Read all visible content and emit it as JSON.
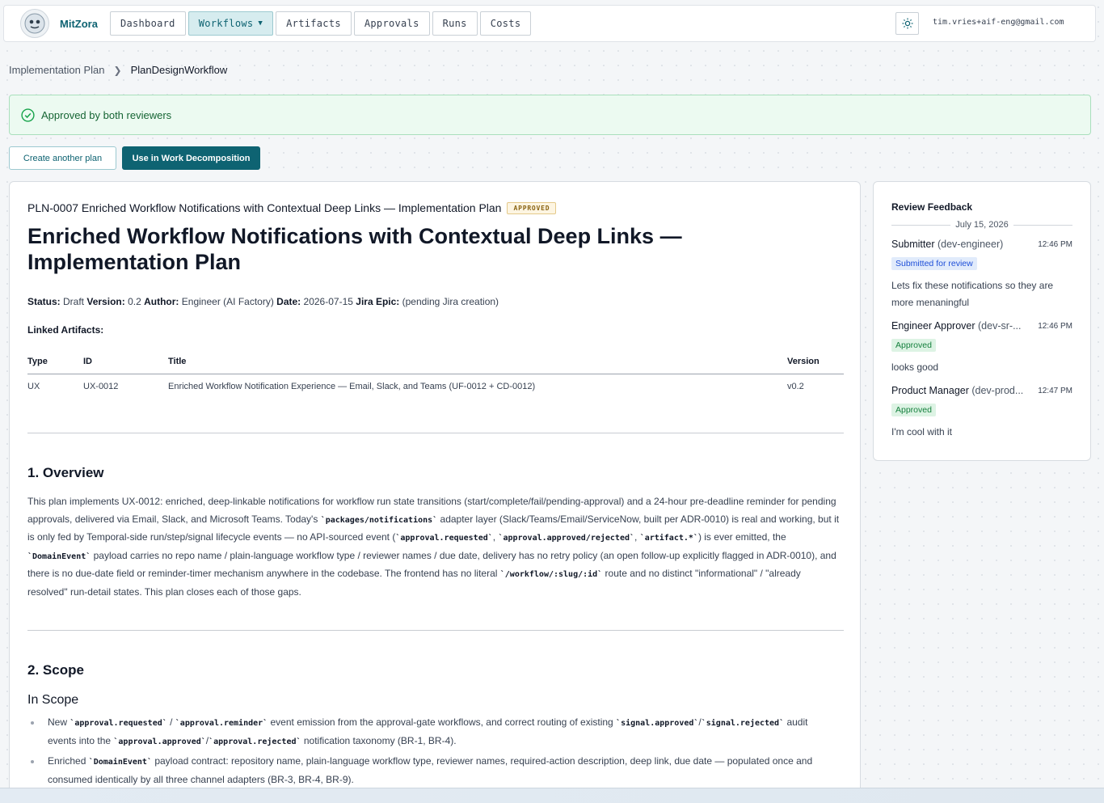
{
  "app": {
    "brand": "MitZora",
    "nav": [
      {
        "label": "Dashboard"
      },
      {
        "label": "Workflows"
      },
      {
        "label": "Artifacts"
      },
      {
        "label": "Approvals"
      },
      {
        "label": "Runs"
      },
      {
        "label": "Costs"
      }
    ],
    "user_email": "tim.vries+aif-eng@gmail.com"
  },
  "breadcrumb": [
    "Implementation Plan",
    "PlanDesignWorkflow"
  ],
  "alert": {
    "text": "Approved by both reviewers"
  },
  "actions": {
    "secondary": "Create another plan",
    "primary": "Use in Work Decomposition"
  },
  "doc": {
    "header": "PLN-0007 Enriched Workflow Notifications with Contextual Deep Links — Implementation Plan",
    "status_badge": "APPROVED",
    "title": "Enriched Workflow Notifications with Contextual Deep Links — Implementation Plan",
    "meta": {
      "status_label": "Status:",
      "status": "Draft",
      "version_label": "Version:",
      "version": "0.2",
      "author_label": "Author:",
      "author": "Engineer (AI Factory)",
      "date_label": "Date:",
      "date": "2026-07-15",
      "jira_label": "Jira Epic:",
      "jira": "(pending Jira creation)"
    },
    "linked_label": "Linked Artifacts:",
    "table": {
      "headers": [
        "Type",
        "ID",
        "Title",
        "Version"
      ],
      "rows": [
        [
          "UX",
          "UX-0012",
          "Enriched Workflow Notification Experience — Email, Slack, and Teams (UF-0012 + CD-0012)",
          "v0.2"
        ]
      ]
    },
    "overview": {
      "heading": "1. Overview",
      "t1": "This plan implements UX-0012: enriched, deep-linkable notifications for workflow run state transitions (start/complete/fail/pending-approval) and a 24-hour pre-deadline reminder for pending approvals, delivered via Email, Slack, and Microsoft Teams. Today's ",
      "c1": "`packages/notifications`",
      "t2": " adapter layer (Slack/Teams/Email/ServiceNow, built per ADR-0010) is real and working, but it is only fed by Temporal-side run/step/signal lifecycle events — no API-sourced event (",
      "c2": "`approval.requested`",
      "t3": ", ",
      "c3": "`approval.approved/rejected`",
      "t4": ", ",
      "c4": "`artifact.*`",
      "t5": ") is ever emitted, the ",
      "c5": "`DomainEvent`",
      "t6": " payload carries no repo name / plain-language workflow type / reviewer names / due date, delivery has no retry policy (an open follow-up explicitly flagged in ADR-0010), and there is no due-date field or reminder-timer mechanism anywhere in the codebase. The frontend has no literal ",
      "c6": "`/workflow/:slug/:id`",
      "t7": " route and no distinct \"informational\" / \"already resolved\" run-detail states. This plan closes each of those gaps."
    },
    "scope": {
      "heading": "2. Scope",
      "in_heading": "In Scope",
      "b1": {
        "t1": "New ",
        "c1": "`approval.requested`",
        "t2": " / ",
        "c2": "`approval.reminder`",
        "t3": " event emission from the approval-gate workflows, and correct routing of existing ",
        "c3": "`signal.approved`",
        "t4": "/",
        "c4": "`signal.rejected`",
        "t5": " audit events into the ",
        "c5": "`approval.approved`",
        "t6": "/",
        "c6": "`approval.rejected`",
        "t7": " notification taxonomy (BR-1, BR-4)."
      },
      "b2": {
        "t1": "Enriched ",
        "c1": "`DomainEvent`",
        "t2": " payload contract: repository name, plain-language workflow type, reviewer names, required-action description, deep link, due date — populated once and consumed identically by all three channel adapters (BR-3, BR-4, BR-9)."
      }
    }
  },
  "review": {
    "title": "Review Feedback",
    "date": "July 15, 2026",
    "items": [
      {
        "name": "Submitter",
        "role": " (dev-engineer)",
        "time": "12:46 PM",
        "status": "Submitted for review",
        "comment": "Lets fix these notifications so they are more menaningful"
      },
      {
        "name": "Engineer Approver",
        "role": " (dev-sr-...",
        "time": "12:46 PM",
        "status": "Approved",
        "comment": "looks good"
      },
      {
        "name": "Product Manager",
        "role": " (dev-prod...",
        "time": "12:47 PM",
        "status": "Approved",
        "comment": "I'm cool with it"
      }
    ]
  },
  "colors": {
    "accent": "#0e6372",
    "success": "#166534",
    "badge": "#8a6413"
  }
}
